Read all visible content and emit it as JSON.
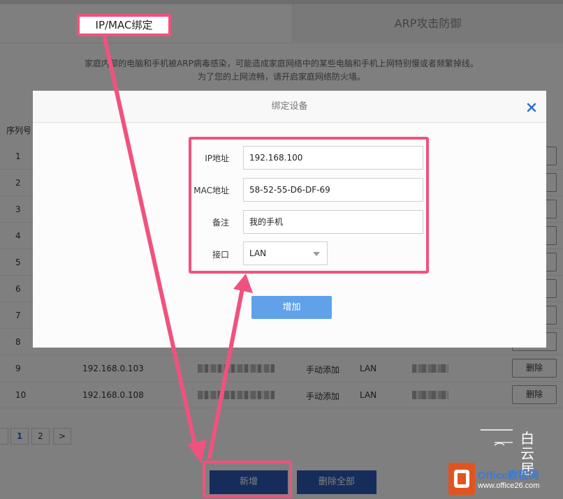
{
  "tabs": {
    "ip_mac": "IP/MAC绑定",
    "arp": "ARP攻击防御"
  },
  "description": {
    "line1": "家庭内部的电脑和手机被ARP病毒感染，可能造成家庭网络中的某些电脑和手机上网特别慢或者频繁掉线。",
    "line2": "为了您的上网流畅，请开启家庭网络防火墙。"
  },
  "table": {
    "seq_header": "序列号",
    "rows": [
      {
        "seq": "1",
        "ip": "",
        "mode": "",
        "iface": ""
      },
      {
        "seq": "2",
        "ip": "",
        "mode": "",
        "iface": ""
      },
      {
        "seq": "3",
        "ip": "",
        "mode": "",
        "iface": ""
      },
      {
        "seq": "4",
        "ip": "",
        "mode": "",
        "iface": ""
      },
      {
        "seq": "5",
        "ip": "",
        "mode": "",
        "iface": ""
      },
      {
        "seq": "6",
        "ip": "",
        "mode": "",
        "iface": ""
      },
      {
        "seq": "7",
        "ip": "",
        "mode": "",
        "iface": ""
      },
      {
        "seq": "8",
        "ip": "",
        "mode": "",
        "iface": ""
      },
      {
        "seq": "9",
        "ip": "192.168.0.103",
        "mode": "手动添加",
        "iface": "LAN"
      },
      {
        "seq": "10",
        "ip": "192.168.0.108",
        "mode": "手动添加",
        "iface": "LAN"
      }
    ],
    "delete_label": "删除"
  },
  "pager": {
    "pages": [
      "1",
      "2"
    ],
    "next": ">",
    "current": "1"
  },
  "buttons": {
    "add": "新增",
    "delete_all": "删除全部"
  },
  "modal": {
    "title": "绑定设备",
    "close": "×",
    "fields": {
      "ip_label": "IP地址",
      "ip_value": "192.168.100",
      "mac_label": "MAC地址",
      "mac_value": "58-52-55-D6-DF-69",
      "note_label": "备注",
      "note_value": "我的手机",
      "iface_label": "接口",
      "iface_value": "LAN"
    },
    "submit": "增加"
  },
  "watermark": {
    "chars": [
      "白",
      "云",
      "居"
    ],
    "site": "Office教程网",
    "url": "www.office26.com"
  },
  "colors": {
    "highlight": "#f0527e",
    "primary_button": "#2d5bb8",
    "modal_button": "#5fa2ea",
    "close_icon": "#2b6fd6"
  }
}
